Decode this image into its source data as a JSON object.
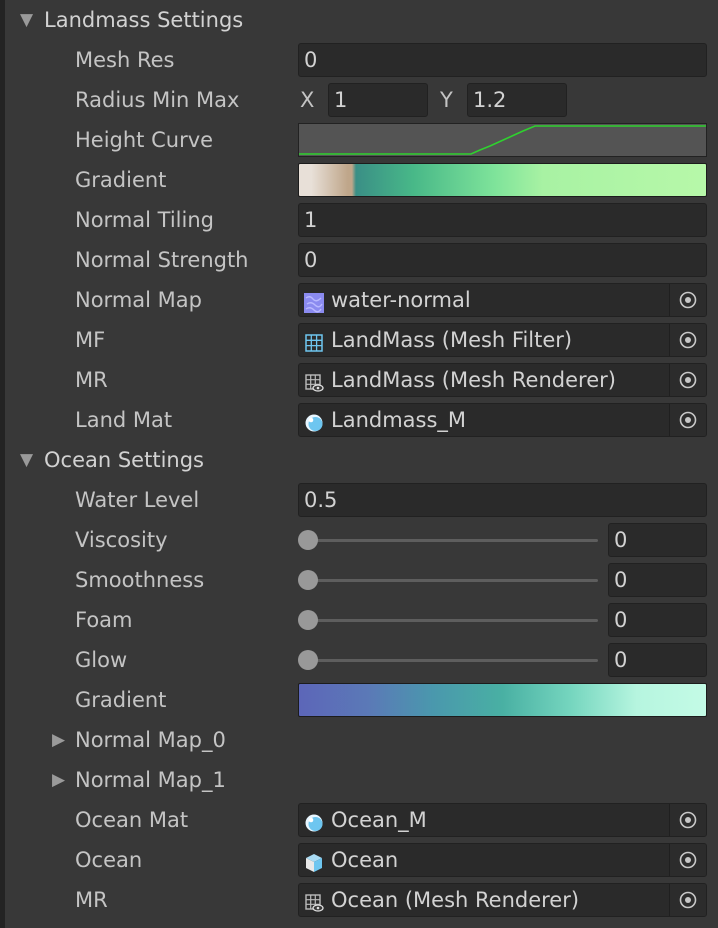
{
  "landmass": {
    "header": "Landmass Settings",
    "mesh_res": {
      "label": "Mesh Res",
      "value": "0"
    },
    "radius": {
      "label": "Radius Min Max",
      "x_label": "X",
      "x_value": "1",
      "y_label": "Y",
      "y_value": "1.2"
    },
    "height_curve": {
      "label": "Height Curve",
      "curve_color": "#2fd12f"
    },
    "gradient": {
      "label": "Gradient",
      "colors": [
        "#e8e0d8",
        "#bfa68a",
        "#3a8f86",
        "#48b888",
        "#7ee39a",
        "#a8f2a3",
        "#b7f8a9"
      ]
    },
    "normal_tiling": {
      "label": "Normal Tiling",
      "value": "1"
    },
    "normal_strength": {
      "label": "Normal Strength",
      "value": "0"
    },
    "normal_map": {
      "label": "Normal Map",
      "value": "water-normal",
      "icon": "normal-map-texture-icon"
    },
    "mf": {
      "label": "MF",
      "value": "LandMass (Mesh Filter)",
      "icon": "mesh-filter-icon"
    },
    "mr": {
      "label": "MR",
      "value": "LandMass (Mesh Renderer)",
      "icon": "mesh-renderer-icon"
    },
    "land_mat": {
      "label": "Land Mat",
      "value": "Landmass_M",
      "icon": "material-sphere-icon"
    }
  },
  "ocean": {
    "header": "Ocean Settings",
    "water_level": {
      "label": "Water Level",
      "value": "0.5"
    },
    "viscosity": {
      "label": "Viscosity",
      "value": "0",
      "fraction": 0
    },
    "smoothness": {
      "label": "Smoothness",
      "value": "0",
      "fraction": 0
    },
    "foam": {
      "label": "Foam",
      "value": "0",
      "fraction": 0
    },
    "glow": {
      "label": "Glow",
      "value": "0",
      "fraction": 0
    },
    "gradient": {
      "label": "Gradient",
      "colors": [
        "#5c66b8",
        "#5b79b7",
        "#4a98ad",
        "#49b0a3",
        "#76d6bf",
        "#b6f5df",
        "#c4fbe6"
      ]
    },
    "normal_map_0": {
      "label": "Normal Map_0"
    },
    "normal_map_1": {
      "label": "Normal Map_1"
    },
    "ocean_mat": {
      "label": "Ocean Mat",
      "value": "Ocean_M",
      "icon": "material-sphere-icon"
    },
    "ocean_obj": {
      "label": "Ocean",
      "value": "Ocean",
      "icon": "prefab-cube-icon"
    },
    "mr": {
      "label": "MR",
      "value": "Ocean (Mesh Renderer)",
      "icon": "mesh-renderer-icon"
    }
  },
  "colors": {
    "accent_icon": "#6ec6f0",
    "slider_knob": "#999999"
  }
}
